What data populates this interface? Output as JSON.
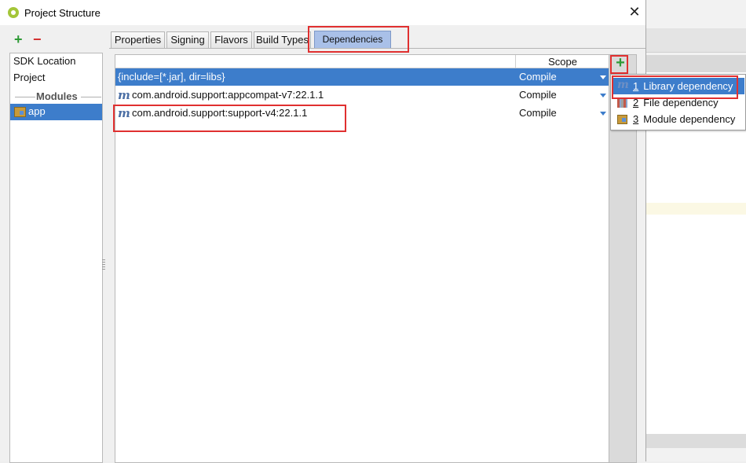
{
  "window": {
    "title": "Project Structure",
    "close_glyph": "✕"
  },
  "modules_panel": {
    "add_glyph": "+",
    "remove_glyph": "−",
    "items": [
      "SDK Location",
      "Project"
    ],
    "section_header": "Modules",
    "selected_module": "app"
  },
  "tabs": [
    {
      "label": "Properties"
    },
    {
      "label": "Signing"
    },
    {
      "label": "Flavors"
    },
    {
      "label": "Build Types"
    },
    {
      "label": "Dependencies",
      "active": true
    }
  ],
  "table": {
    "scope_header": "Scope",
    "rows": [
      {
        "name": "{include=[*.jar], dir=libs}",
        "scope": "Compile",
        "selected": true,
        "icon": "none"
      },
      {
        "name": "com.android.support:appcompat-v7:22.1.1",
        "scope": "Compile",
        "icon": "maven-m-icon"
      },
      {
        "name": "com.android.support:support-v4:22.1.1",
        "scope": "Compile",
        "icon": "maven-m-icon"
      }
    ]
  },
  "add_dependency_glyph": "+",
  "add_menu": {
    "items": [
      {
        "mnemonic": "1",
        "label": "Library dependency",
        "highlighted": true,
        "icon": "library-icon"
      },
      {
        "mnemonic": "2",
        "label": "File dependency",
        "icon": "file-icon"
      },
      {
        "mnemonic": "3",
        "label": "Module dependency",
        "icon": "module-icon"
      }
    ]
  },
  "colors": {
    "selection": "#3d7dcb",
    "callout": "#e03030",
    "add_green": "#2f9a36",
    "remove_red": "#d33030"
  }
}
